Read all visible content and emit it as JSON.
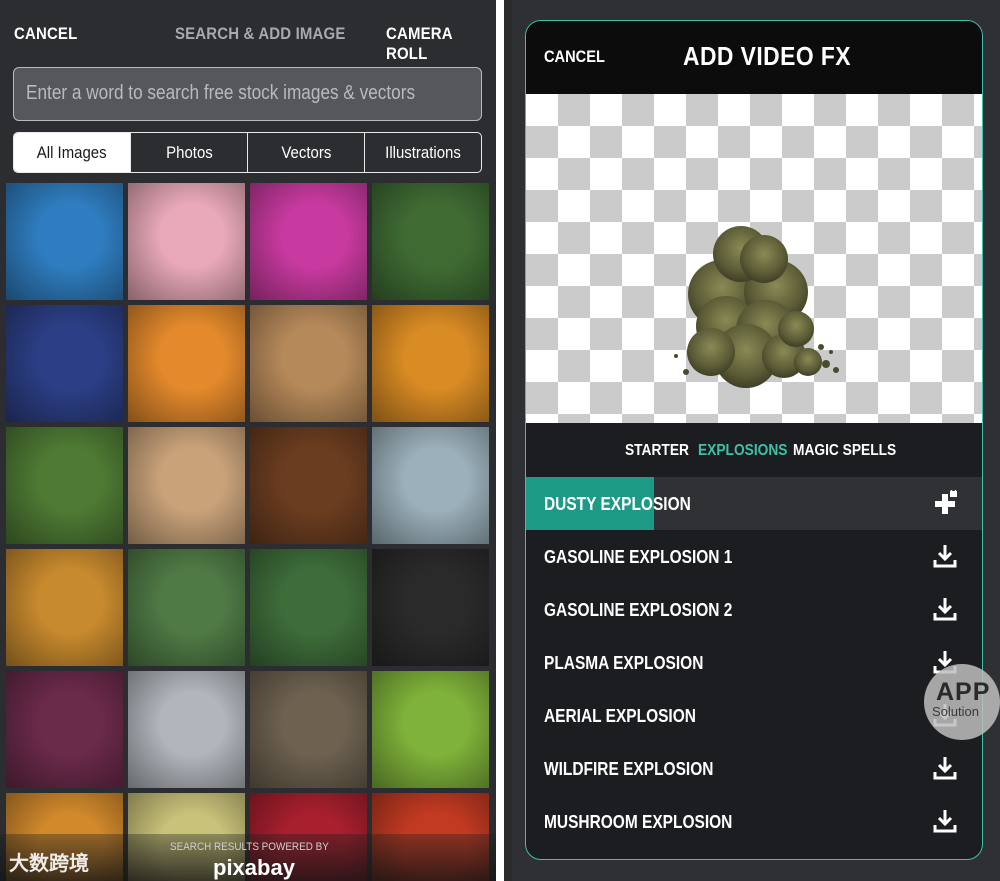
{
  "left_app": {
    "topbar": {
      "cancel": "CANCEL",
      "title": "SEARCH & ADD IMAGE",
      "camera_roll": "CAMERA ROLL"
    },
    "search": {
      "placeholder": "Enter a word to search free stock images & vectors"
    },
    "segments": [
      {
        "label": "All Images",
        "selected": true
      },
      {
        "label": "Photos",
        "selected": false
      },
      {
        "label": "Vectors",
        "selected": false
      },
      {
        "label": "Illustrations",
        "selected": false
      }
    ],
    "images": [
      {
        "name": "blue-door-latch",
        "color": "#2f7dc0"
      },
      {
        "name": "pink-rose",
        "color": "#e9a9b8"
      },
      {
        "name": "magenta-dahlia",
        "color": "#c93aa0"
      },
      {
        "name": "scarlet-ibis",
        "color": "#3f6b33"
      },
      {
        "name": "jefferson-memorial",
        "color": "#2c3f86"
      },
      {
        "name": "sunset-sky",
        "color": "#e58a2c"
      },
      {
        "name": "bread-loaf",
        "color": "#b6895a"
      },
      {
        "name": "sun-flare",
        "color": "#d98b24"
      },
      {
        "name": "sheep-toys",
        "color": "#4e7a34"
      },
      {
        "name": "flag-and-beer",
        "color": "#c9a27a"
      },
      {
        "name": "teddy-bear",
        "color": "#6b3d20"
      },
      {
        "name": "red-ornaments",
        "color": "#9bb0ba"
      },
      {
        "name": "golden-grass",
        "color": "#c88a2e"
      },
      {
        "name": "fox-reflection",
        "color": "#4f7a45"
      },
      {
        "name": "spider-web",
        "color": "#3e6d3a"
      },
      {
        "name": "man-portrait",
        "color": "#2a2a2a"
      },
      {
        "name": "purple-sunset",
        "color": "#6a2a4a"
      },
      {
        "name": "goose",
        "color": "#b0b6bc"
      },
      {
        "name": "old-bicycle",
        "color": "#6d6150"
      },
      {
        "name": "green-snake",
        "color": "#7fb23a"
      },
      {
        "name": "orange-flower",
        "color": "#d1892c"
      },
      {
        "name": "yellow-pasta",
        "color": "#c9c27a"
      },
      {
        "name": "pomegranate",
        "color": "#a81f2e"
      },
      {
        "name": "peppers",
        "color": "#c23a22"
      }
    ],
    "footer": {
      "powered_by": "SEARCH RESULTS POWERED BY",
      "brand": "pixabay",
      "watermark": "大数跨境"
    }
  },
  "right_app": {
    "header": {
      "cancel": "CANCEL",
      "title": "ADD VIDEO FX"
    },
    "categories": [
      {
        "label": "STARTER",
        "selected": false
      },
      {
        "label": "EXPLOSIONS",
        "selected": true
      },
      {
        "label": "MAGIC SPELLS",
        "selected": false
      }
    ],
    "effects": [
      {
        "name": "DUSTY EXPLOSION",
        "icon": "add-locked-icon",
        "active": true,
        "progress": 0.28
      },
      {
        "name": "GASOLINE EXPLOSION 1",
        "icon": "download-icon"
      },
      {
        "name": "GASOLINE EXPLOSION 2",
        "icon": "download-icon"
      },
      {
        "name": "PLASMA EXPLOSION",
        "icon": "download-icon"
      },
      {
        "name": "AERIAL EXPLOSION",
        "icon": "download-icon"
      },
      {
        "name": "WILDFIRE EXPLOSION",
        "icon": "download-icon"
      },
      {
        "name": "MUSHROOM EXPLOSION",
        "icon": "download-icon"
      }
    ],
    "accent_color": "#3ec1a9"
  },
  "badge": {
    "line1": "APP",
    "line2": "Solution"
  }
}
